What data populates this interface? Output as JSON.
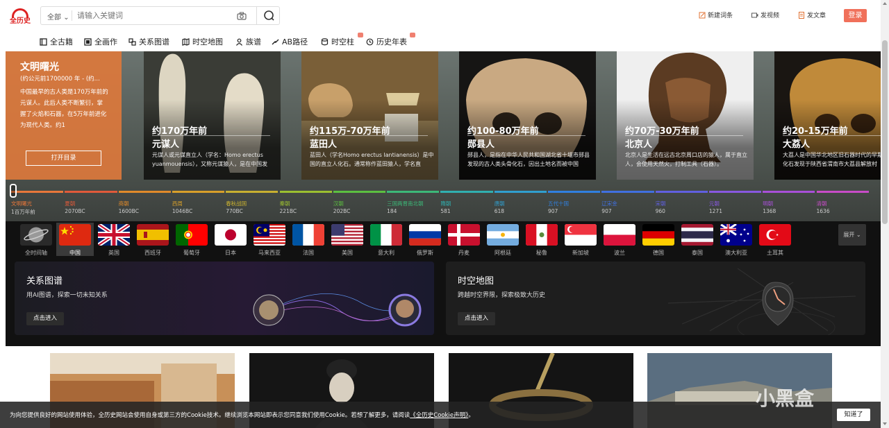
{
  "header": {
    "logo_text": "全历史",
    "search_scope": "全部",
    "search_placeholder": "请输入关键词",
    "actions": [
      {
        "label": "新建词条",
        "icon": "edit-icon"
      },
      {
        "label": "发视频",
        "icon": "video-icon"
      },
      {
        "label": "发文章",
        "icon": "document-icon"
      }
    ],
    "login_label": "登录"
  },
  "nav": {
    "items": [
      {
        "label": "全古籍",
        "icon": "book-icon",
        "new": false
      },
      {
        "label": "全画作",
        "icon": "painting-icon",
        "new": false
      },
      {
        "label": "关系图谱",
        "icon": "graph-icon",
        "new": false
      },
      {
        "label": "时空地图",
        "icon": "map-icon",
        "new": false
      },
      {
        "label": "族谱",
        "icon": "person-icon",
        "new": false
      },
      {
        "label": "AB路径",
        "icon": "path-icon",
        "new": false
      },
      {
        "label": "时空柱",
        "icon": "database-icon",
        "new": true
      },
      {
        "label": "历史年表",
        "icon": "clock-icon",
        "new": true
      }
    ]
  },
  "banner": {
    "intro": {
      "title": "文明曙光",
      "subtitle": "(约公元前1700000 年 - (约...",
      "description": "中国最早的古人类是170万年前的元谋人。此后人类不断繁衍，掌握了火焰和石器，在5万年前进化为现代人类。约1",
      "button": "打开目录"
    },
    "cards": [
      {
        "time": "约170万年前",
        "name": "元谋人",
        "desc": "元谋人或元谋直立人（学名：Homo erectus yuanmouensis），又称元谋猿人，是在中国发"
      },
      {
        "time": "约115万-70万年前",
        "name": "蓝田人",
        "desc": "蓝田人（学名Homo erectus lantianensis）是中国的直立人化石。通常称作蓝田猿人，学名直"
      },
      {
        "time": "约100-80万年前",
        "name": "郧县人",
        "desc": "郧县人，是指在中华人民共和国湖北省十堰市郧县发现的古人类头骨化石，因出土地名而被中国"
      },
      {
        "time": "约70万-30万年前",
        "name": "北京人",
        "desc": "北京人是生活在远古北京周口店的猿人，属于直立人，会使用天然火，打制工具（石器）。"
      },
      {
        "time": "约20-15万年前",
        "name": "大荔人",
        "desc": "大荔人是中国华北地区旧石器时代的早期智人，因化石发现于陕西省渭南市大荔县解放村"
      }
    ]
  },
  "timeline": [
    {
      "name": "文明曙光",
      "year": "1百万年前",
      "color": "#e8773a"
    },
    {
      "name": "夏朝",
      "year": "2070BC",
      "color": "#e05a3a"
    },
    {
      "name": "商朝",
      "year": "1600BC",
      "color": "#e08a2a"
    },
    {
      "name": "西周",
      "year": "1046BC",
      "color": "#d8a02a"
    },
    {
      "name": "春秋战国",
      "year": "770BC",
      "color": "#c8b030"
    },
    {
      "name": "秦朝",
      "year": "221BC",
      "color": "#9cc030"
    },
    {
      "name": "汉朝",
      "year": "202BC",
      "color": "#5cc040"
    },
    {
      "name": "三国两晋南北朝",
      "year": "184",
      "color": "#3cb878"
    },
    {
      "name": "隋朝",
      "year": "581",
      "color": "#30b0b0"
    },
    {
      "name": "唐朝",
      "year": "618",
      "color": "#30a0d0"
    },
    {
      "name": "五代十国",
      "year": "907",
      "color": "#3080e0"
    },
    {
      "name": "辽宋金",
      "year": "907",
      "color": "#4070e0"
    },
    {
      "name": "宋朝",
      "year": "960",
      "color": "#6060e0"
    },
    {
      "name": "元朝",
      "year": "1271",
      "color": "#8858e0"
    },
    {
      "name": "明朝",
      "year": "1368",
      "color": "#a850d8"
    },
    {
      "name": "清朝",
      "year": "1636",
      "color": "#c84cc8"
    }
  ],
  "countries": [
    {
      "name": "全时间轴",
      "flag": "globe-icon"
    },
    {
      "name": "中国",
      "flag": "china-flag"
    },
    {
      "name": "英国",
      "flag": "uk-flag"
    },
    {
      "name": "西班牙",
      "flag": "spain-flag"
    },
    {
      "name": "葡萄牙",
      "flag": "portugal-flag"
    },
    {
      "name": "日本",
      "flag": "japan-flag"
    },
    {
      "name": "马来西亚",
      "flag": "malaysia-flag"
    },
    {
      "name": "法国",
      "flag": "france-flag"
    },
    {
      "name": "美国",
      "flag": "usa-flag"
    },
    {
      "name": "意大利",
      "flag": "italy-flag"
    },
    {
      "name": "俄罗斯",
      "flag": "russia-flag"
    },
    {
      "name": "丹麦",
      "flag": "denmark-flag"
    },
    {
      "name": "阿根廷",
      "flag": "argentina-flag"
    },
    {
      "name": "秘鲁",
      "flag": "peru-flag"
    },
    {
      "name": "新加坡",
      "flag": "singapore-flag"
    },
    {
      "name": "波兰",
      "flag": "poland-flag"
    },
    {
      "name": "德国",
      "flag": "germany-flag"
    },
    {
      "name": "泰国",
      "flag": "thailand-flag"
    },
    {
      "name": "澳大利亚",
      "flag": "australia-flag"
    },
    {
      "name": "土耳其",
      "flag": "turkey-flag"
    }
  ],
  "expand_label": "展开",
  "features": [
    {
      "title": "关系图谱",
      "subtitle": "用AI图谱，探索一切未知关系",
      "button": "点击进入"
    },
    {
      "title": "时空地图",
      "subtitle": "跨越时空界限，探索极致大历史",
      "button": "点击进入"
    }
  ],
  "cookie": {
    "text_before": "为向您提供良好的网站使用体验，全历史网站会使用自身或第三方的Cookie技术。继续浏览本网站即表示您同意我们使用Cookie。若想了解更多，请阅读",
    "link": "《全历史Cookie声明》",
    "text_after": "。",
    "button": "知道了"
  },
  "watermark": "小黑盒",
  "colors": {
    "accent": "#f0705a",
    "logo": "#dd2222",
    "intro_panel": "#dc783c"
  }
}
